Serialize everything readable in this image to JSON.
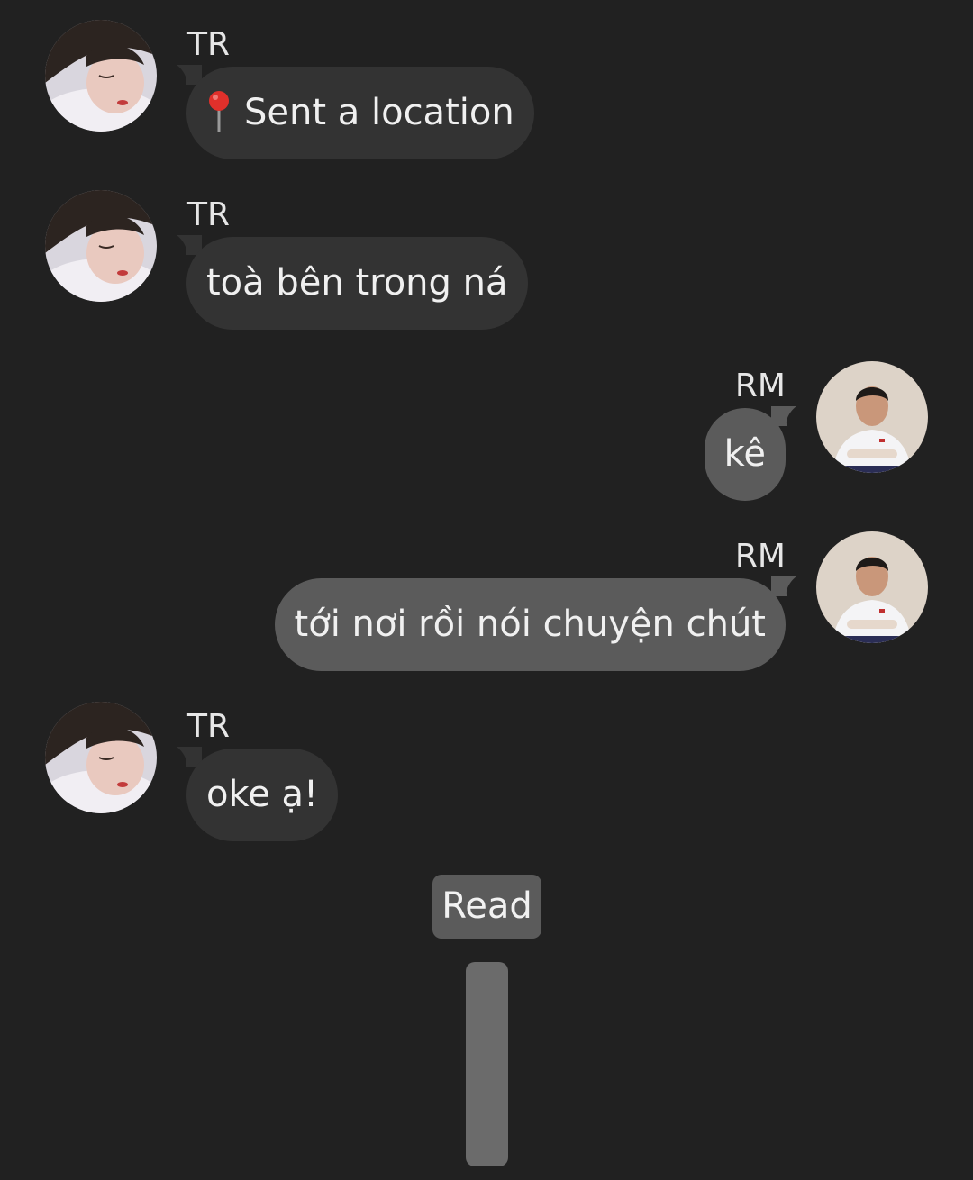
{
  "messages": [
    {
      "sender": "TR",
      "text": "Sent a location",
      "icon": "map-pin-icon"
    },
    {
      "sender": "TR",
      "text": "toà bên trong ná"
    },
    {
      "sender": "RM",
      "text": "kê"
    },
    {
      "sender": "RM",
      "text": "tới nơi rồi nói chuyện chút"
    },
    {
      "sender": "TR",
      "text": "oke ạ!"
    }
  ],
  "status": {
    "read_label": "Read"
  },
  "colors": {
    "background": "#212121",
    "incoming_bubble": "#333333",
    "outgoing_bubble": "#5b5b5b",
    "text": "#f0f0f0"
  }
}
